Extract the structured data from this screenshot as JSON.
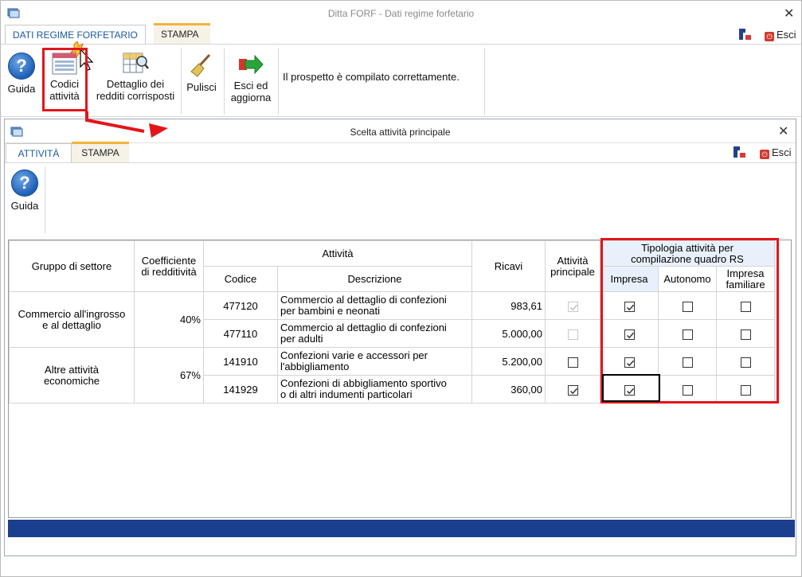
{
  "outer": {
    "title": "Ditta FORF - Dati regime forfetario",
    "tabs": [
      {
        "label": "DATI REGIME FORFETARIO"
      },
      {
        "label": "STAMPA"
      }
    ],
    "esci_label": "Esci",
    "ribbon": {
      "guida": "Guida",
      "codici_attivita": [
        "Codici",
        "attività"
      ],
      "dettaglio_redditi": [
        "Dettaglio dei",
        "redditi corrisposti"
      ],
      "pulisci": "Pulisci",
      "esci_aggiorna": [
        "Esci ed",
        "aggiorna"
      ],
      "status": "Il prospetto è compilato correttamente."
    }
  },
  "inner": {
    "title": "Scelta attività principale",
    "tabs": [
      {
        "label": "ATTIVITÀ"
      },
      {
        "label": "STAMPA"
      }
    ],
    "esci_label": "Esci",
    "guida": "Guida"
  },
  "table": {
    "headers": {
      "gruppo": "Gruppo di settore",
      "coefficiente": [
        "Coefficiente",
        "di redditività"
      ],
      "attivita": "Attività",
      "codice": "Codice",
      "descrizione": "Descrizione",
      "ricavi": "Ricavi",
      "attivita_principale": [
        "Attività",
        "principale"
      ],
      "tipologia": [
        "Tipologia attività per",
        "compilazione quadro RS"
      ],
      "impresa": "Impresa",
      "autonomo": "Autonomo",
      "impresa_familiare": [
        "Impresa",
        "familiare"
      ]
    },
    "groups": [
      {
        "gruppo": [
          "Commercio all'ingrosso",
          "e al dettaglio"
        ],
        "coefficiente": "40%",
        "rows": [
          {
            "codice": "477120",
            "descrizione": [
              "Commercio al dettaglio di confezioni",
              "per bambini e neonati"
            ],
            "ricavi": "983,61",
            "principale": true,
            "principale_disabled": true,
            "impresa": true,
            "autonomo": false,
            "familiare": false
          },
          {
            "codice": "477110",
            "descrizione": [
              "Commercio al dettaglio di confezioni",
              "per adulti"
            ],
            "ricavi": "5.000,00",
            "principale": false,
            "principale_disabled": true,
            "impresa": true,
            "autonomo": false,
            "familiare": false
          }
        ]
      },
      {
        "gruppo": [
          "Altre attività",
          "economiche"
        ],
        "coefficiente": "67%",
        "rows": [
          {
            "codice": "141910",
            "descrizione": [
              "Confezioni varie e accessori per",
              "l'abbigliamento"
            ],
            "ricavi": "5.200,00",
            "principale": false,
            "principale_disabled": false,
            "impresa": true,
            "autonomo": false,
            "familiare": false
          },
          {
            "codice": "141929",
            "descrizione": [
              "Confezioni di abbigliamento sportivo",
              "o di altri indumenti particolari"
            ],
            "ricavi": "360,00",
            "principale": true,
            "principale_disabled": false,
            "impresa": true,
            "autonomo": false,
            "familiare": false
          }
        ]
      }
    ]
  },
  "colors": {
    "accent_tab": "#f3b33b",
    "highlight_red": "#e3151a",
    "footer_blue": "#1b3f8f",
    "tab_blue": "#1a5aa3"
  }
}
